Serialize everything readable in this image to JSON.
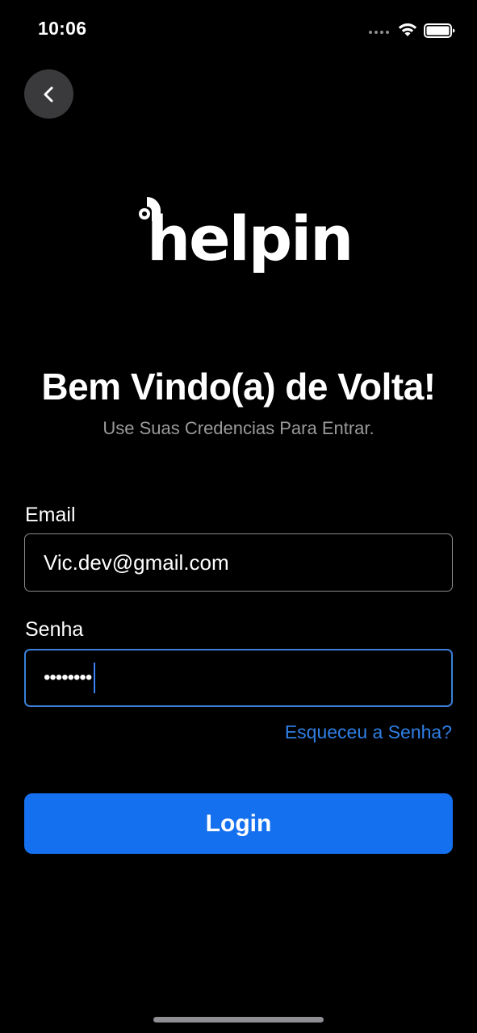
{
  "status_bar": {
    "time": "10:06",
    "icons": [
      "signal-icon",
      "wifi-icon",
      "battery-icon"
    ]
  },
  "nav": {
    "back_icon": "chevron-left-icon"
  },
  "logo": {
    "text": "helpin"
  },
  "header": {
    "title": "Bem Vindo(a) de Volta!",
    "subtitle": "Use Suas Credencias Para Entrar."
  },
  "form": {
    "email_label": "Email",
    "email_value": "Vic.dev@gmail.com",
    "password_label": "Senha",
    "password_value": "••••••••",
    "forgot_link": "Esqueceu a Senha?",
    "login_label": "Login"
  },
  "colors": {
    "background": "#000000",
    "accent": "#1570ef",
    "link": "#2f7fe5",
    "subtitle": "#9a9a9a"
  }
}
